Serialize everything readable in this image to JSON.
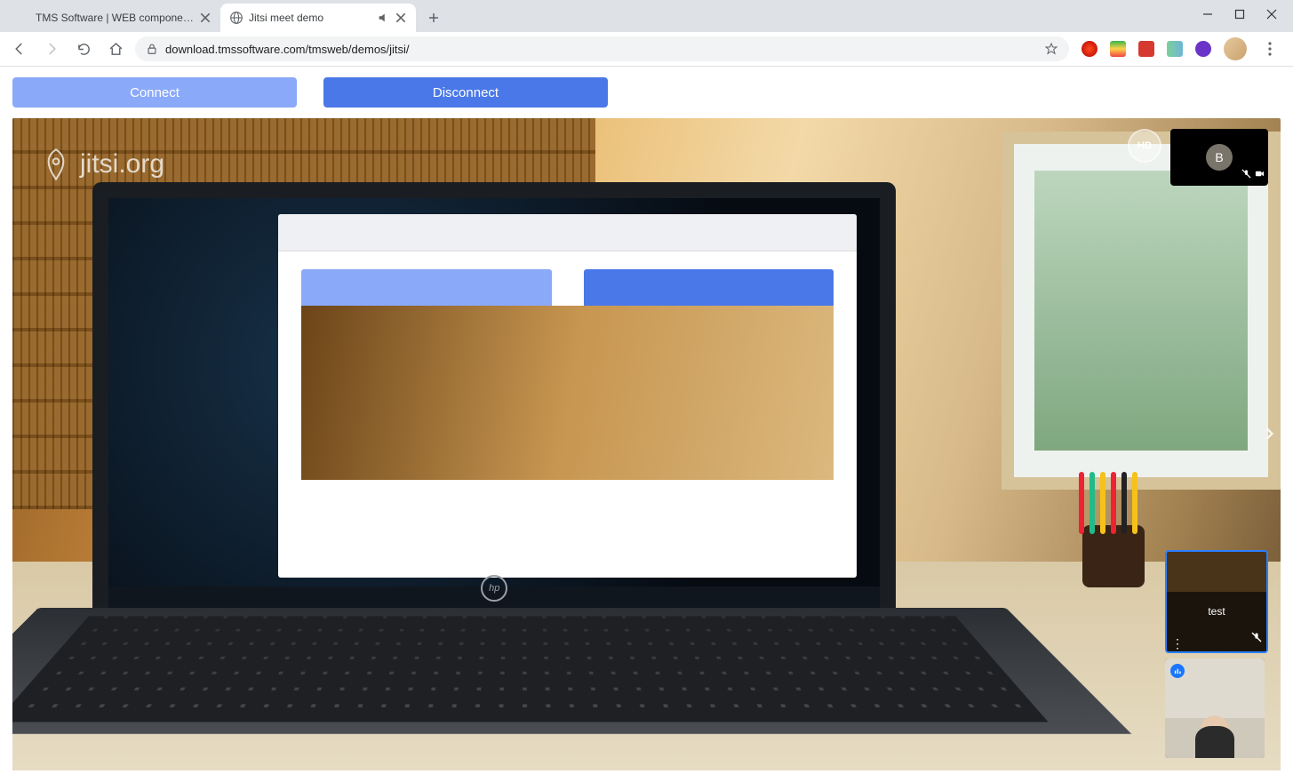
{
  "window": {
    "minimize": "–",
    "maximize": "□",
    "close": "×"
  },
  "tabs": [
    {
      "title": "TMS Software | WEB components"
    },
    {
      "title": "Jitsi meet demo"
    }
  ],
  "newTabTooltip": "New tab",
  "toolbar": {
    "url": "download.tmssoftware.com/tmsweb/demos/jitsi/",
    "back": "Back",
    "forward": "Forward",
    "reload": "Reload",
    "home": "Home",
    "secure": "Secure",
    "bookmark": "Bookmark this page"
  },
  "page": {
    "connectLabel": "Connect",
    "disconnectLabel": "Disconnect"
  },
  "jitsi": {
    "brand": "jitsi.org",
    "hd": "HD",
    "participantInitial": "B",
    "thumb1Label": "test",
    "hpLogo": "hp"
  }
}
